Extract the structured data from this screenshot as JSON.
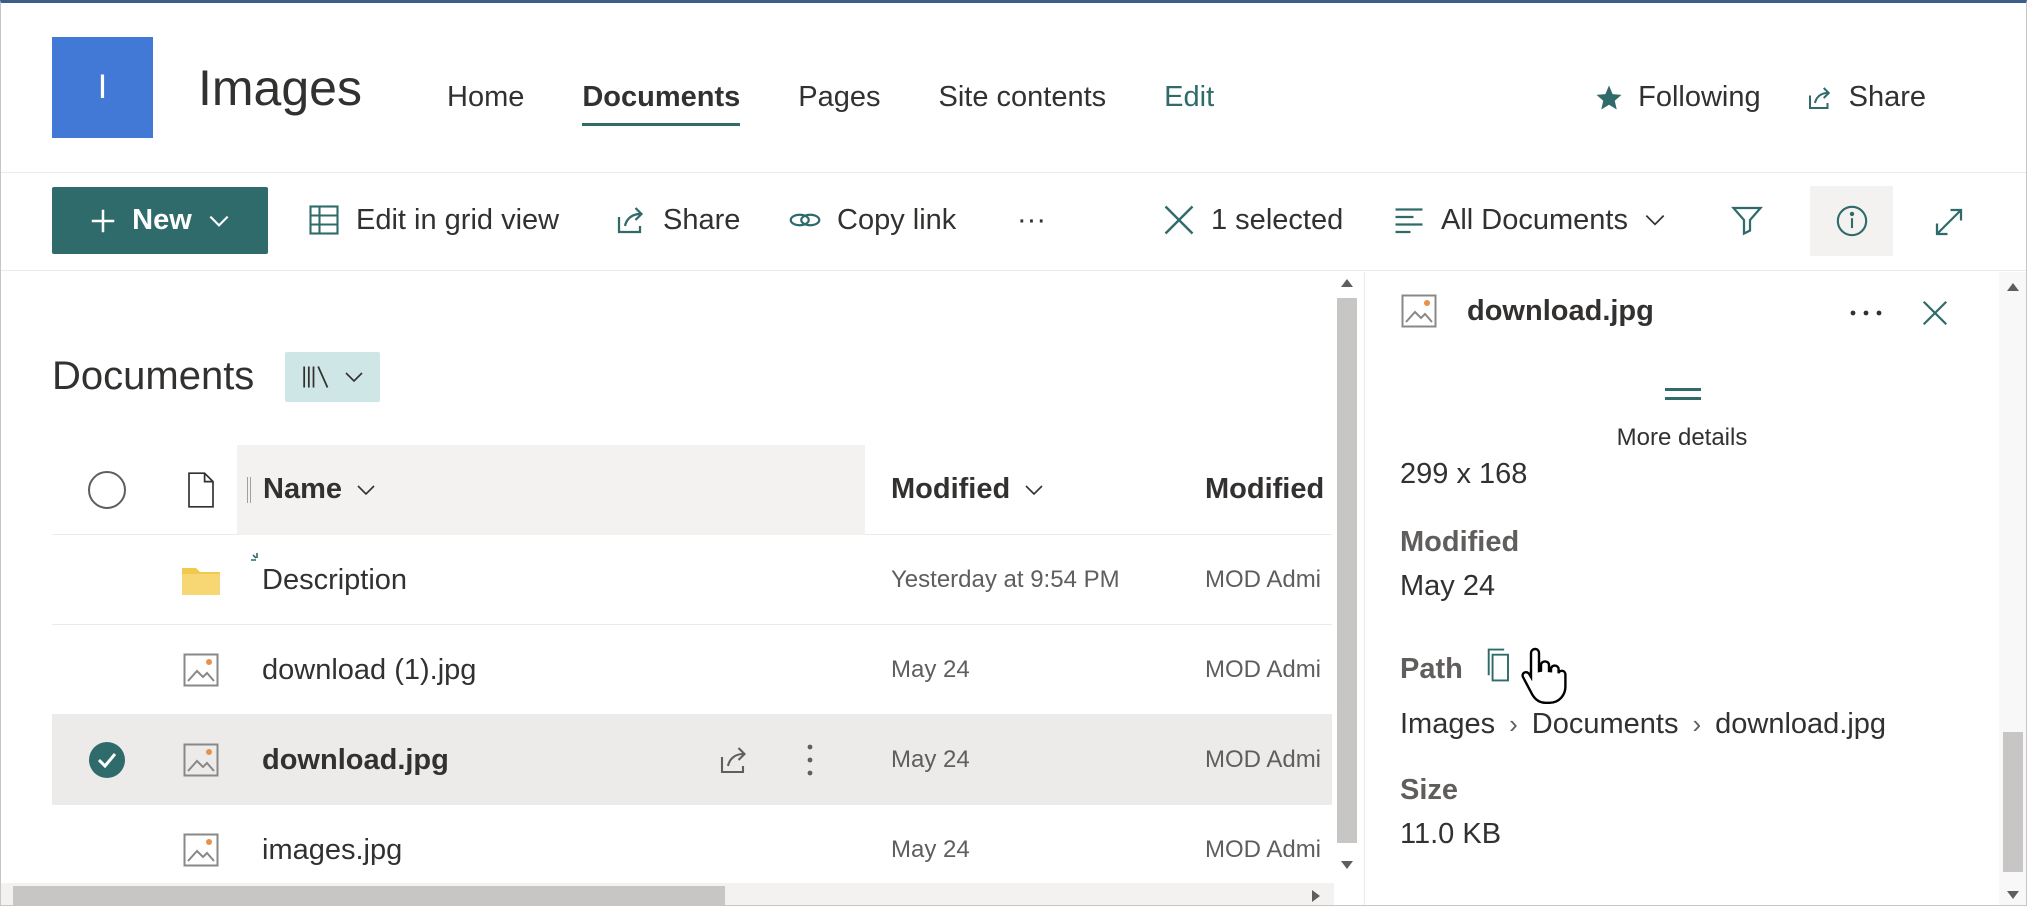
{
  "site": {
    "logo_letter": "I",
    "title": "Images",
    "nav": [
      {
        "label": "Home",
        "active": false
      },
      {
        "label": "Documents",
        "active": true
      },
      {
        "label": "Pages",
        "active": false
      },
      {
        "label": "Site contents",
        "active": false
      },
      {
        "label": "Edit",
        "active": false
      }
    ],
    "following_label": "Following",
    "share_label": "Share"
  },
  "toolbar": {
    "new_label": "New",
    "edit_grid_label": "Edit in grid view",
    "share_label": "Share",
    "copy_link_label": "Copy link",
    "more_label": "···",
    "selected_label": "1 selected",
    "view_label": "All Documents"
  },
  "library": {
    "title": "Documents",
    "columns": {
      "name": "Name",
      "modified": "Modified",
      "modified_by": "Modified"
    },
    "rows": [
      {
        "name": "Description",
        "type": "folder",
        "modified": "Yesterday at 9:54 PM",
        "modified_by": "MOD Admi",
        "selected": false
      },
      {
        "name": "download (1).jpg",
        "type": "image",
        "modified": "May 24",
        "modified_by": "MOD Admi",
        "selected": false
      },
      {
        "name": "download.jpg",
        "type": "image",
        "modified": "May 24",
        "modified_by": "MOD Admi",
        "selected": true
      },
      {
        "name": "images.jpg",
        "type": "image",
        "modified": "May 24",
        "modified_by": "MOD Admi",
        "selected": false
      }
    ]
  },
  "details": {
    "file_name": "download.jpg",
    "more_details_label": "More details",
    "dimensions": "299 x 168",
    "modified_label": "Modified",
    "modified_value": "May 24",
    "path_label": "Path",
    "path": [
      "Images",
      "Documents",
      "download.jpg"
    ],
    "size_label": "Size",
    "size_value": "11.0 KB"
  },
  "colors": {
    "accent": "#2f6b6b",
    "logo": "#4379d6",
    "folder": "#f2c94c"
  }
}
